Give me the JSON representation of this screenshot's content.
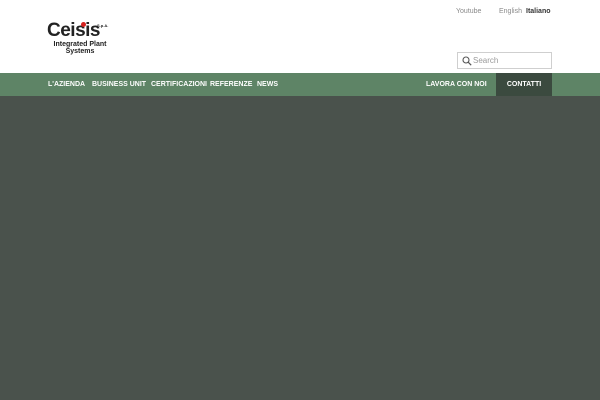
{
  "logo": {
    "word": "Ceisis",
    "spa": "S.p.A.",
    "tagline": "Integrated Plant Systems"
  },
  "top_links": {
    "youtube": "Youtube",
    "english": "English",
    "italiano": "Italiano"
  },
  "search": {
    "placeholder": "Search",
    "value": ""
  },
  "nav": {
    "items": [
      "L'AZIENDA",
      "BUSINESS UNIT",
      "CERTIFICAZIONI",
      "REFERENZE",
      "NEWS"
    ],
    "lavora": "LAVORA CON NOI",
    "contatti": "CONTATTI"
  },
  "colors": {
    "nav_bg": "#5e8466",
    "nav_active_bg": "#3b4a3f",
    "hero_bg": "#4a524c",
    "logo_accent": "#d4201d"
  }
}
